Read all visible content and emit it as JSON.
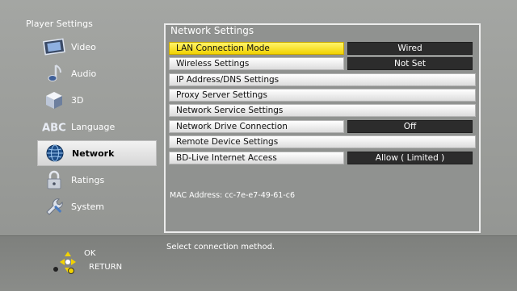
{
  "sidebar": {
    "title": "Player Settings",
    "items": [
      {
        "label": "Video",
        "icon": "film-icon"
      },
      {
        "label": "Audio",
        "icon": "music-note-icon"
      },
      {
        "label": "3D",
        "icon": "cube-icon"
      },
      {
        "label": "Language",
        "icon": "abc-icon"
      },
      {
        "label": "Network",
        "icon": "globe-icon",
        "selected": true
      },
      {
        "label": "Ratings",
        "icon": "padlock-icon"
      },
      {
        "label": "System",
        "icon": "wrench-icon"
      }
    ]
  },
  "panel": {
    "title": "Network Settings",
    "rows": [
      {
        "label": "LAN Connection Mode",
        "value": "Wired",
        "highlighted": true
      },
      {
        "label": "Wireless Settings",
        "value": "Not Set"
      },
      {
        "label": "IP Address/DNS Settings"
      },
      {
        "label": "Proxy Server Settings"
      },
      {
        "label": "Network Service Settings"
      },
      {
        "label": "Network Drive Connection",
        "value": "Off"
      },
      {
        "label": "Remote Device Settings"
      },
      {
        "label": "BD-Live Internet Access",
        "value": "Allow ( Limited )"
      }
    ],
    "mac_address": "MAC Address: cc-7e-e7-49-61-c6"
  },
  "footer": {
    "hint": "Select connection method.",
    "ok_label": "OK",
    "return_label": "RETURN"
  },
  "colors": {
    "highlight": "#f2d200",
    "value_bg": "#2c2c2c",
    "selected_sidebar_bg": "#e8e8e8"
  }
}
